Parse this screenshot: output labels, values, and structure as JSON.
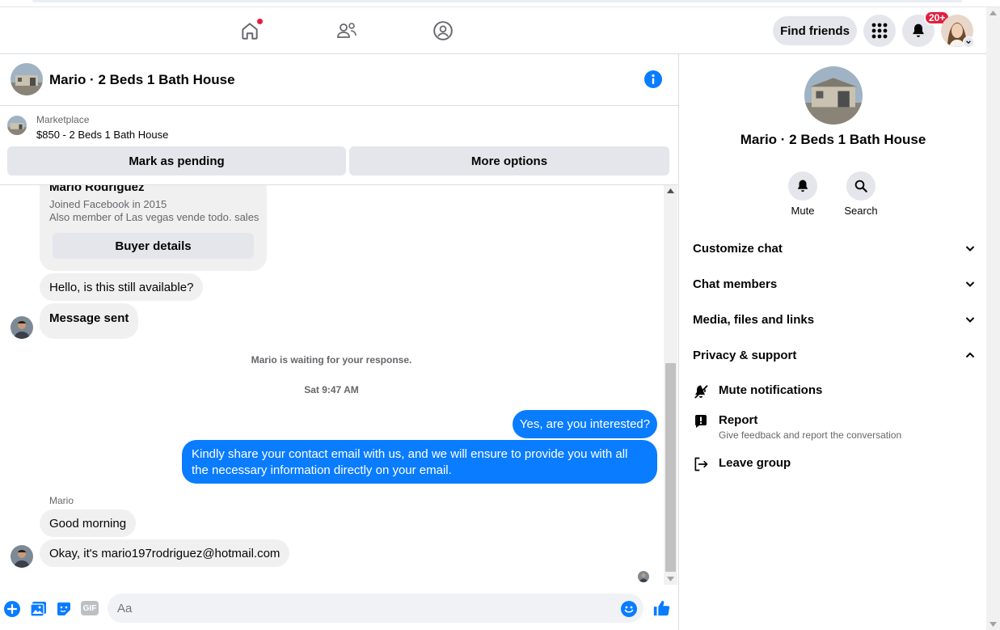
{
  "nav": {
    "find_friends": "Find friends",
    "notification_badge": "20+"
  },
  "chat": {
    "title": "Mario · 2 Beds 1 Bath House"
  },
  "marketplace": {
    "label": "Marketplace",
    "price_title": "$850 - 2 Beds 1 Bath House",
    "mark_pending": "Mark as pending",
    "more_options": "More options"
  },
  "buyer": {
    "name": "Mario Rodriguez",
    "joined": "Joined Facebook in 2015",
    "member_of": "Also member of Las vegas vende todo. sales",
    "details_button": "Buyer details"
  },
  "messages": {
    "m1": "Hello, is this still available?",
    "m2": "Message sent",
    "waiting": "Mario is waiting for your response.",
    "timestamp": "Sat 9:47 AM",
    "out1": "Yes, are you interested?",
    "out2": "Kindly share your contact email with us, and we will ensure to provide you with all the necessary information directly on your email.",
    "sender": "Mario",
    "in1": "Good morning",
    "in2": "Okay, it's mario197rodriguez@hotmail.com"
  },
  "composer": {
    "placeholder": "Aa",
    "gif": "GIF"
  },
  "panel": {
    "title": "Mario · 2 Beds 1 Bath House",
    "mute": "Mute",
    "search": "Search",
    "customize": "Customize chat",
    "members": "Chat members",
    "media": "Media, files and links",
    "privacy": "Privacy & support",
    "mute_notifications": "Mute notifications",
    "report": "Report",
    "report_desc": "Give feedback and report the conversation",
    "leave": "Leave group"
  },
  "colors": {
    "accent": "#0a7cff",
    "badge": "#e41e3f",
    "bubble_in": "#f0f0f0",
    "button_bg": "#e4e6eb"
  },
  "icons": {
    "home": "home-icon",
    "friends": "friends-icon",
    "groups": "groups-icon",
    "menu": "grid-menu-icon",
    "bell": "bell-icon",
    "info": "info-icon",
    "add": "plus-circle-icon",
    "photo": "photo-icon",
    "sticker": "sticker-icon",
    "gif": "gif-icon",
    "emoji": "emoji-icon",
    "like": "thumbs-up-icon"
  }
}
